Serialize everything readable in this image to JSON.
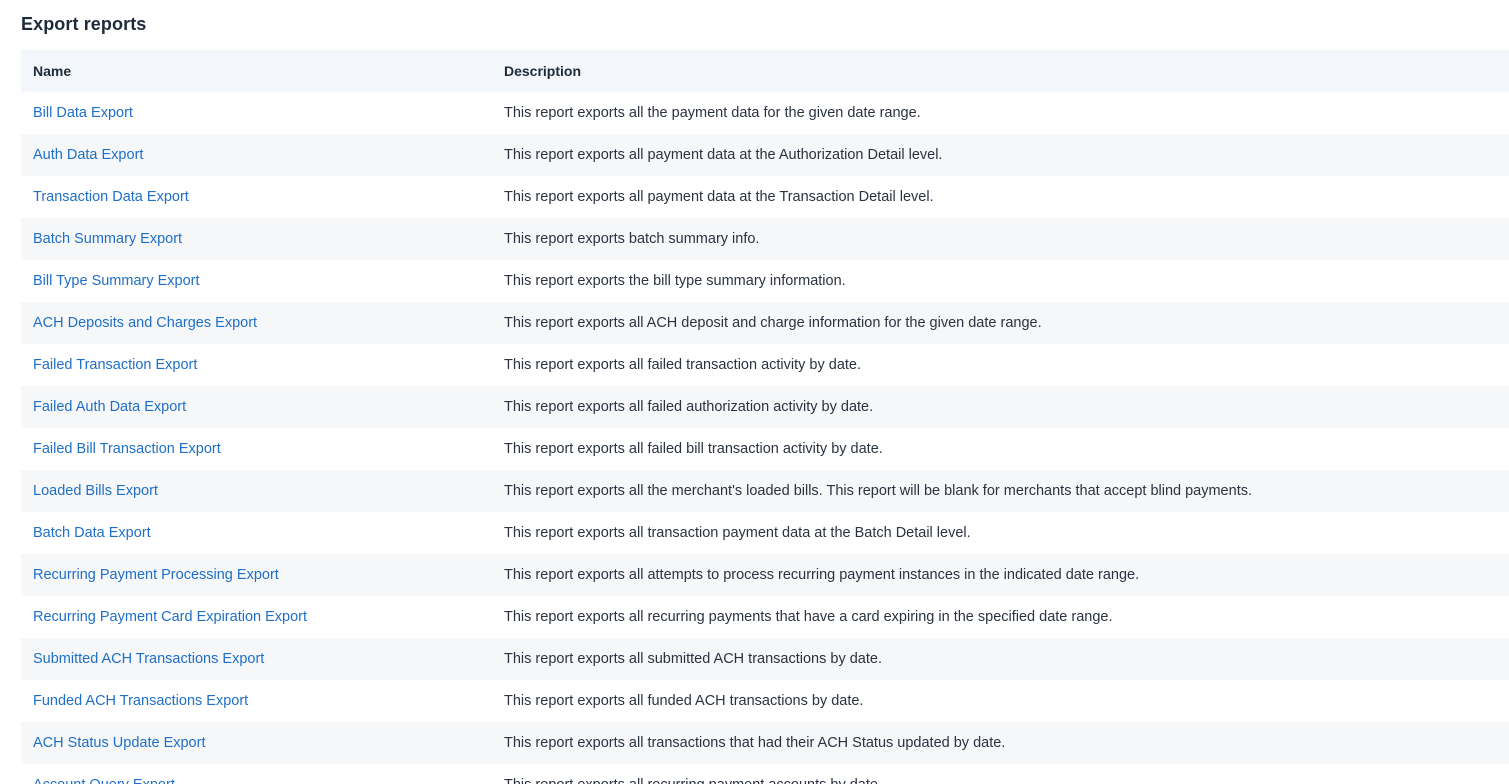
{
  "page": {
    "title": "Export reports"
  },
  "table": {
    "headers": {
      "name": "Name",
      "description": "Description"
    },
    "rows": [
      {
        "name": "Bill Data Export",
        "description": "This report exports all the payment data for the given date range."
      },
      {
        "name": "Auth Data Export",
        "description": "This report exports all payment data at the Authorization Detail level."
      },
      {
        "name": "Transaction Data Export",
        "description": "This report exports all payment data at the Transaction Detail level."
      },
      {
        "name": "Batch Summary Export",
        "description": "This report exports batch summary info."
      },
      {
        "name": "Bill Type Summary Export",
        "description": "This report exports the bill type summary information."
      },
      {
        "name": "ACH Deposits and Charges Export",
        "description": "This report exports all ACH deposit and charge information for the given date range."
      },
      {
        "name": "Failed Transaction Export",
        "description": "This report exports all failed transaction activity by date."
      },
      {
        "name": "Failed Auth Data Export",
        "description": "This report exports all failed authorization activity by date."
      },
      {
        "name": "Failed Bill Transaction Export",
        "description": "This report exports all failed bill transaction activity by date."
      },
      {
        "name": "Loaded Bills Export",
        "description": "This report exports all the merchant's loaded bills. This report will be blank for merchants that accept blind payments."
      },
      {
        "name": "Batch Data Export",
        "description": "This report exports all transaction payment data at the Batch Detail level."
      },
      {
        "name": "Recurring Payment Processing Export",
        "description": "This report exports all attempts to process recurring payment instances in the indicated date range."
      },
      {
        "name": "Recurring Payment Card Expiration Export",
        "description": "This report exports all recurring payments that have a card expiring in the specified date range."
      },
      {
        "name": "Submitted ACH Transactions Export",
        "description": "This report exports all submitted ACH transactions by date."
      },
      {
        "name": "Funded ACH Transactions Export",
        "description": "This report exports all funded ACH transactions by date."
      },
      {
        "name": "ACH Status Update Export",
        "description": "This report exports all transactions that had their ACH Status updated by date."
      },
      {
        "name": "Account Query Export",
        "description": "This report exports all recurring payment accounts by date."
      }
    ]
  }
}
